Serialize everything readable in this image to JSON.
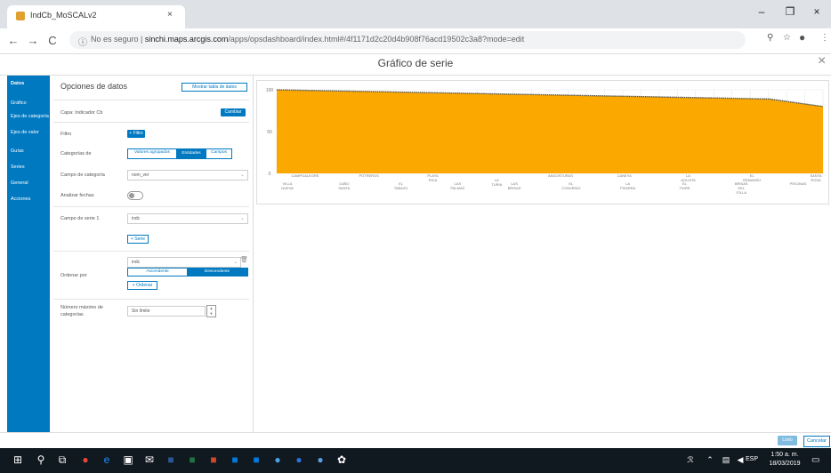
{
  "browser": {
    "tab_title": "IndCb_MoSCALv2",
    "tab_close": "×",
    "min_glyph": "–",
    "max_glyph": "❐",
    "close_glyph": "×",
    "back_glyph": "←",
    "forward_glyph": "→",
    "reload_glyph": "C",
    "security_text": "No es seguro",
    "url_host": "sinchi.maps.arcgis.com",
    "url_path": "/apps/opsdashboard/index.html#/4f1171d2c20d4b908f76acd19502c3a8?mode=edit",
    "zoom_glyph": "⚲",
    "star_glyph": "☆",
    "menu_glyph": "⋮"
  },
  "dialog": {
    "title": "Gráfico de serie",
    "close_glyph": "×"
  },
  "sidebar": {
    "items": [
      {
        "label": "Datos",
        "active": true
      },
      {
        "label": "Gráfico"
      },
      {
        "label": "Ejes de categoría"
      },
      {
        "label": "Ejes de valor"
      },
      {
        "label": "Guías"
      },
      {
        "label": "Series"
      },
      {
        "label": "General"
      },
      {
        "label": "Acciones"
      }
    ]
  },
  "panel": {
    "heading": "Opciones de datos",
    "show_table_button": "Mostrar tabla de datos",
    "layer_label": "Capa: Indicador Cb",
    "change_button": "Cambiar",
    "filter_label": "Filtro",
    "filter_button": "+ Filtro",
    "categories_label": "Categorías de",
    "categories_options": [
      "Valores agrupados",
      "Entidades",
      "Campos"
    ],
    "category_field_label": "Campo de categoría",
    "category_field_value": "nom_ver",
    "analyze_dates_label": "Analizar fechas",
    "series_field_label": "Campo de serie 1",
    "series_field_value": "indc",
    "add_series_button": "+ Serie",
    "order_label": "Ordenar por",
    "order_field_value": "indc",
    "order_options": [
      "Ascendente",
      "Descendente"
    ],
    "add_order_button": "+ Ordenar",
    "max_categories_label": "Número máximo de categorías",
    "max_categories_value": "Sin límite"
  },
  "chart_data": {
    "type": "area",
    "ylim": [
      0,
      100
    ],
    "y_ticks": [
      "100",
      "50",
      "0"
    ],
    "fill_color": "#fba800",
    "line_color": "#555555",
    "x_start": 100,
    "x_end": 80,
    "x_labels_top": [
      "CAMPOALEGRE",
      "POTREROS",
      "PLAYA\nRICA",
      "\nLA\nTURIA",
      "ANGOSTURAS",
      "CANEYA",
      "LA\nAGUJITA",
      "EL\nREMANSO",
      "SANTA\nROSA"
    ],
    "x_labels_bottom": [
      "VILLA\nNUEVA",
      "CAÑO\nSANTA",
      "EL\nTABAZO",
      "LAS\nPALMAS",
      "LAS\nBRISAS",
      "EL\nCONVENIO",
      "LA\nPIZARRA",
      "EL\nTIGRE",
      "BRISAS\nDEL\nITILLA",
      "PISCINAS"
    ]
  },
  "footer": {
    "done_button": "Listo",
    "cancel_button": "Cancelar"
  },
  "taskbar": {
    "lang": "ESP",
    "time": "1:50 a. m.",
    "date": "18/03/2019"
  }
}
